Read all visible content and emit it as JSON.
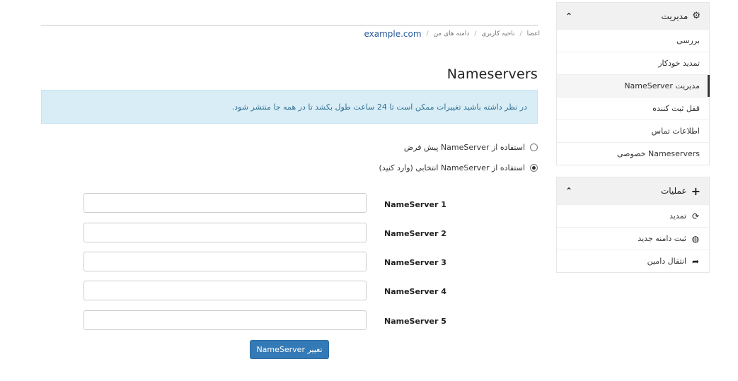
{
  "breadcrumb": {
    "items": [
      "اعضا",
      "ناحیه کاربری",
      "دامنه های من"
    ],
    "separator": "/",
    "active": "example.com"
  },
  "page": {
    "title": "Nameservers",
    "alert": "در نظر داشته باشید تغییرات ممکن است تا 24 ساعت طول بکشد تا در همه جا منتشر شود."
  },
  "options": {
    "default_label": "استفاده از NameServer پیش فرض",
    "custom_label": "استفاده از NameServer انتخابی (وارد کنید)",
    "selected": "custom"
  },
  "nameservers": [
    {
      "label": "NameServer 1",
      "value": ""
    },
    {
      "label": "NameServer 2",
      "value": ""
    },
    {
      "label": "NameServer 3",
      "value": ""
    },
    {
      "label": "NameServer 4",
      "value": ""
    },
    {
      "label": "NameServer 5",
      "value": ""
    }
  ],
  "submit_label": "تغییر NameServer",
  "sidebar": {
    "manage": {
      "title": "مدیریت",
      "icon": "gear-icon",
      "items": [
        {
          "label": "بررسی"
        },
        {
          "label": "تمدید خودکار"
        },
        {
          "label": "مدیریت NameServer",
          "active": true
        },
        {
          "label": "قفل ثبت کننده"
        },
        {
          "label": "اطلاعات تماس"
        },
        {
          "label": "Nameservers خصوصی"
        }
      ]
    },
    "actions": {
      "title": "عملیات",
      "icon": "plus-icon",
      "items": [
        {
          "label": "تمدید",
          "icon": "refresh-icon"
        },
        {
          "label": "ثبت دامنه جدید",
          "icon": "globe-icon"
        },
        {
          "label": "انتقال دامین",
          "icon": "share-arrow-icon"
        }
      ]
    }
  },
  "colors": {
    "primary": "#337ab7",
    "alert_bg": "#d9edf7",
    "alert_text": "#31708f",
    "link": "#2a5a9a"
  }
}
